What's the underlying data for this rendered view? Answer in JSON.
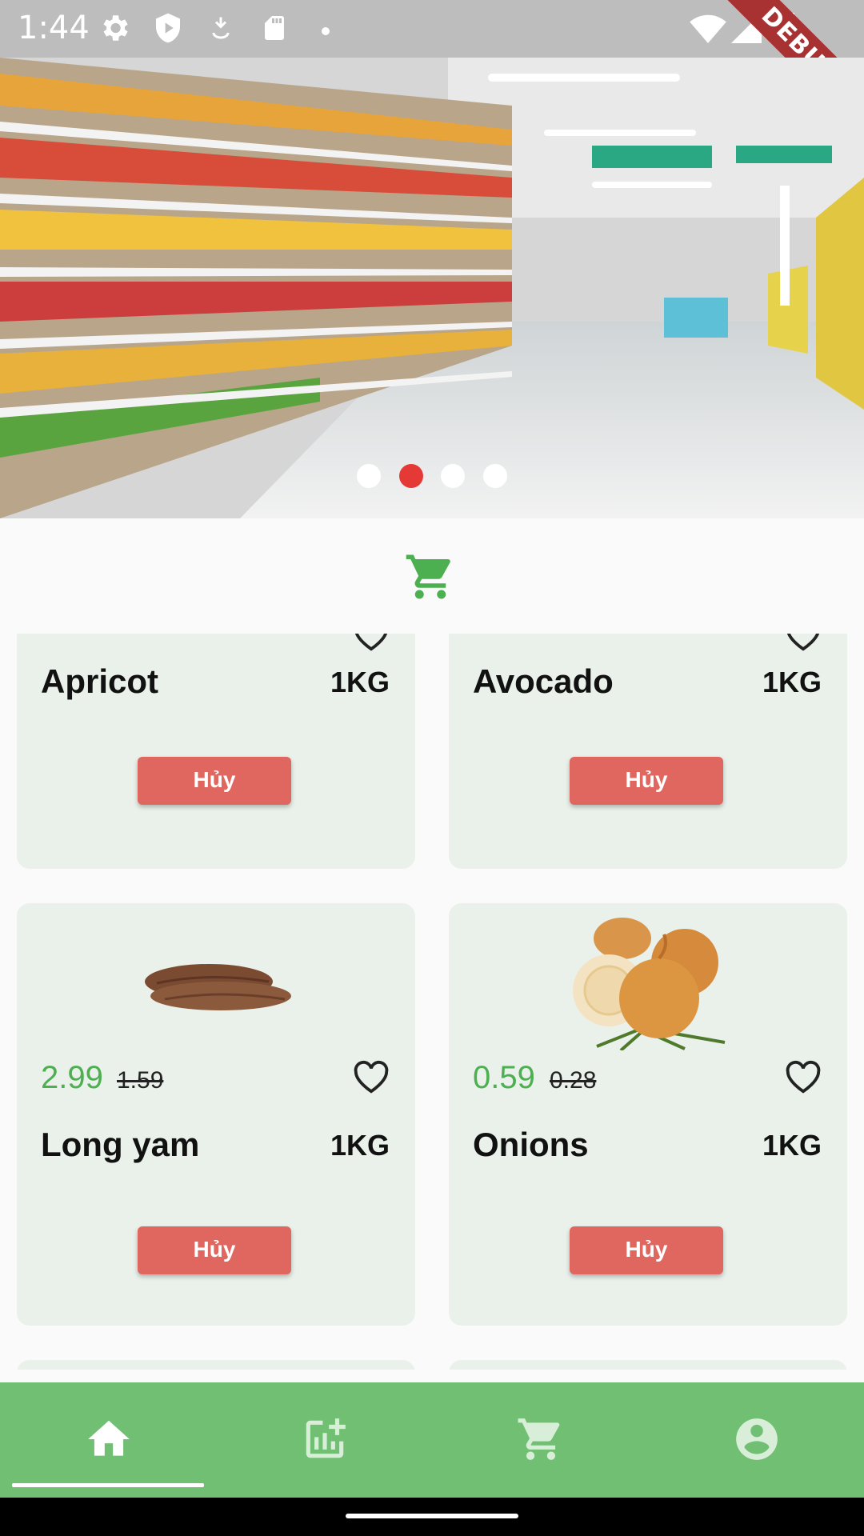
{
  "status_bar": {
    "time": "1:44",
    "debug_label": "DEBUG"
  },
  "banner": {
    "active_index": 1,
    "count": 4
  },
  "products": [
    {
      "name": "Apricot",
      "unit": "1KG",
      "price": "",
      "old_price": "",
      "button": "Hủy"
    },
    {
      "name": "Avocado",
      "unit": "1KG",
      "price": "",
      "old_price": "",
      "button": "Hủy"
    },
    {
      "name": "Long yam",
      "unit": "1KG",
      "price": "2.99",
      "old_price": "1.59",
      "button": "Hủy"
    },
    {
      "name": "Onions",
      "unit": "1KG",
      "price": "0.59",
      "old_price": "0.28",
      "button": "Hủy"
    }
  ],
  "bottom_nav": {
    "items": [
      {
        "icon": "home-icon",
        "active": true
      },
      {
        "icon": "add-chart-icon",
        "active": false
      },
      {
        "icon": "cart-icon",
        "active": false
      },
      {
        "icon": "account-icon",
        "active": false
      }
    ]
  },
  "colors": {
    "accent": "#71bf72",
    "price": "#4caf50",
    "button": "#e0675f",
    "card": "#e9f1ea"
  }
}
